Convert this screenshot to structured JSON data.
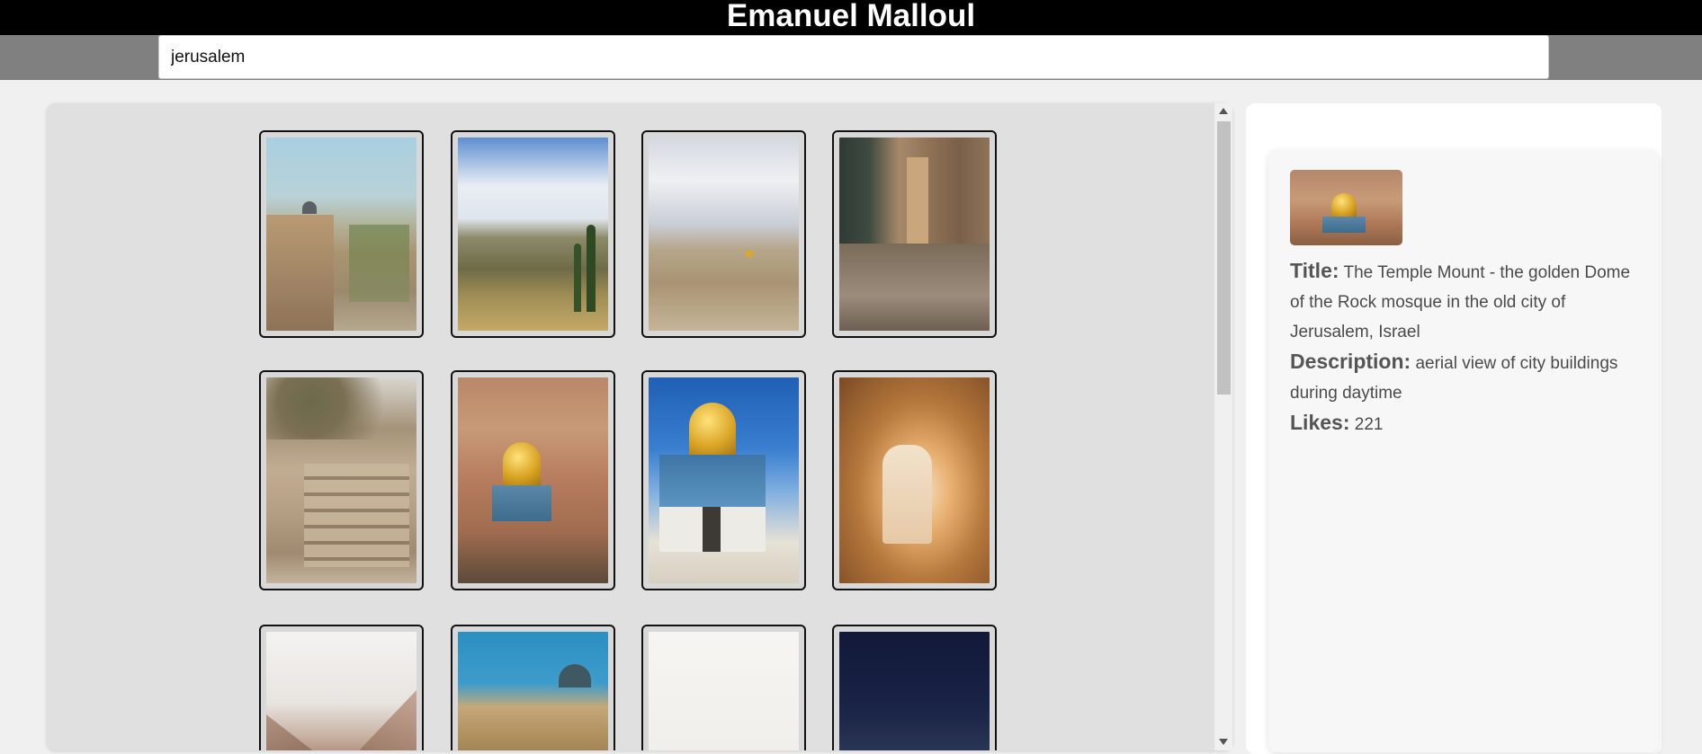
{
  "header": {
    "title": "Emanuel Malloul"
  },
  "search": {
    "value": "jerusalem"
  },
  "details": {
    "title_label": "Title:",
    "title_value": "The Temple Mount - the golden Dome of the Rock mosque in the old city of Jerusalem, Israel",
    "description_label": "Description:",
    "description_value": "aerial view of city buildings during daytime",
    "likes_label": "Likes:",
    "likes_value": "221"
  },
  "gallery": {
    "images": [
      {
        "name": "jerusalem-wall-hillside-photo"
      },
      {
        "name": "jerusalem-panorama-cypress-photo"
      },
      {
        "name": "jerusalem-cloudy-panorama-photo"
      },
      {
        "name": "old-city-alley-photo"
      },
      {
        "name": "stone-stairs-olive-trees-photo"
      },
      {
        "name": "dome-of-rock-aerial-photo"
      },
      {
        "name": "dome-of-rock-closeup-photo"
      },
      {
        "name": "stone-cave-tunnel-photo"
      },
      {
        "name": "misty-desert-valley-photo"
      },
      {
        "name": "city-wall-blue-dome-photo"
      },
      {
        "name": "white-haze-photo"
      },
      {
        "name": "night-sky-photo"
      }
    ]
  }
}
